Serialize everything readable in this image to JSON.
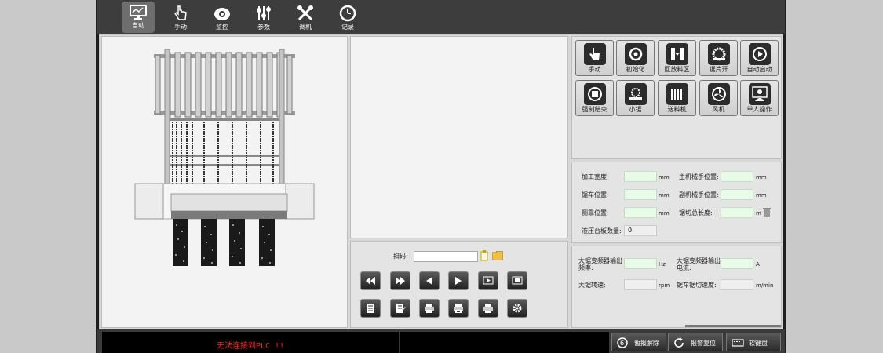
{
  "nav": {
    "items": [
      {
        "label": "自动",
        "icon": "monitor-chart-icon"
      },
      {
        "label": "手动",
        "icon": "hand-pointer-icon"
      },
      {
        "label": "监控",
        "icon": "camera-icon"
      },
      {
        "label": "参数",
        "icon": "sliders-icon"
      },
      {
        "label": "调机",
        "icon": "tools-icon"
      },
      {
        "label": "记录",
        "icon": "clock-icon"
      }
    ],
    "active": "自动"
  },
  "actions": {
    "row1": [
      "手动",
      "初始化",
      "回放料区",
      "锯片开",
      "自动启动"
    ],
    "row2": [
      "强制结束",
      "小锯",
      "送料机",
      "风机",
      "单人操作"
    ]
  },
  "scan": {
    "label": "扫码:",
    "value": ""
  },
  "controls": {
    "row1_icons": [
      "fast-backward-icon",
      "fast-forward-icon",
      "step-back-icon",
      "step-forward-icon",
      "screen-play-icon",
      "screen-stop-icon"
    ],
    "row2_icons": [
      "doc-list-icon",
      "doc-edit-icon",
      "print-icon",
      "print-multi-icon",
      "print-next-icon",
      "settings-gear-icon"
    ]
  },
  "params": {
    "process_width": {
      "label": "加工宽度:",
      "value": "",
      "unit": "mm"
    },
    "main_arm_pos": {
      "label": "主机械手位置:",
      "value": "",
      "unit": "mm"
    },
    "saw_pos": {
      "label": "锯车位置:",
      "value": "",
      "unit": "mm"
    },
    "sub_arm_pos": {
      "label": "副机械手位置:",
      "value": "",
      "unit": "mm"
    },
    "side_pos": {
      "label": "侧靠位置:",
      "value": "",
      "unit": "mm"
    },
    "saw_total_len": {
      "label": "锯切总长度:",
      "value": "",
      "unit": "m"
    },
    "hydraulic_count": {
      "label": "液压台板数量:",
      "value": "0"
    }
  },
  "inverter": {
    "freq": {
      "label": "大锯变频器输出频率:",
      "value": "",
      "unit": "Hz"
    },
    "current": {
      "label": "大锯变频器输出电流:",
      "value": "",
      "unit": "A"
    },
    "speed": {
      "label": "大锯转速:",
      "value": "",
      "unit": "rpm"
    },
    "cut_speed": {
      "label": "锯车锯切速度:",
      "value": "",
      "unit": "m/min"
    }
  },
  "status": {
    "message": "无法连接到PLC !!",
    "message_color": "#ff2020"
  },
  "footer": {
    "alarm_release": "暂报解除",
    "alarm_reset": "报警复位",
    "soft_keyboard": "软键盘"
  }
}
